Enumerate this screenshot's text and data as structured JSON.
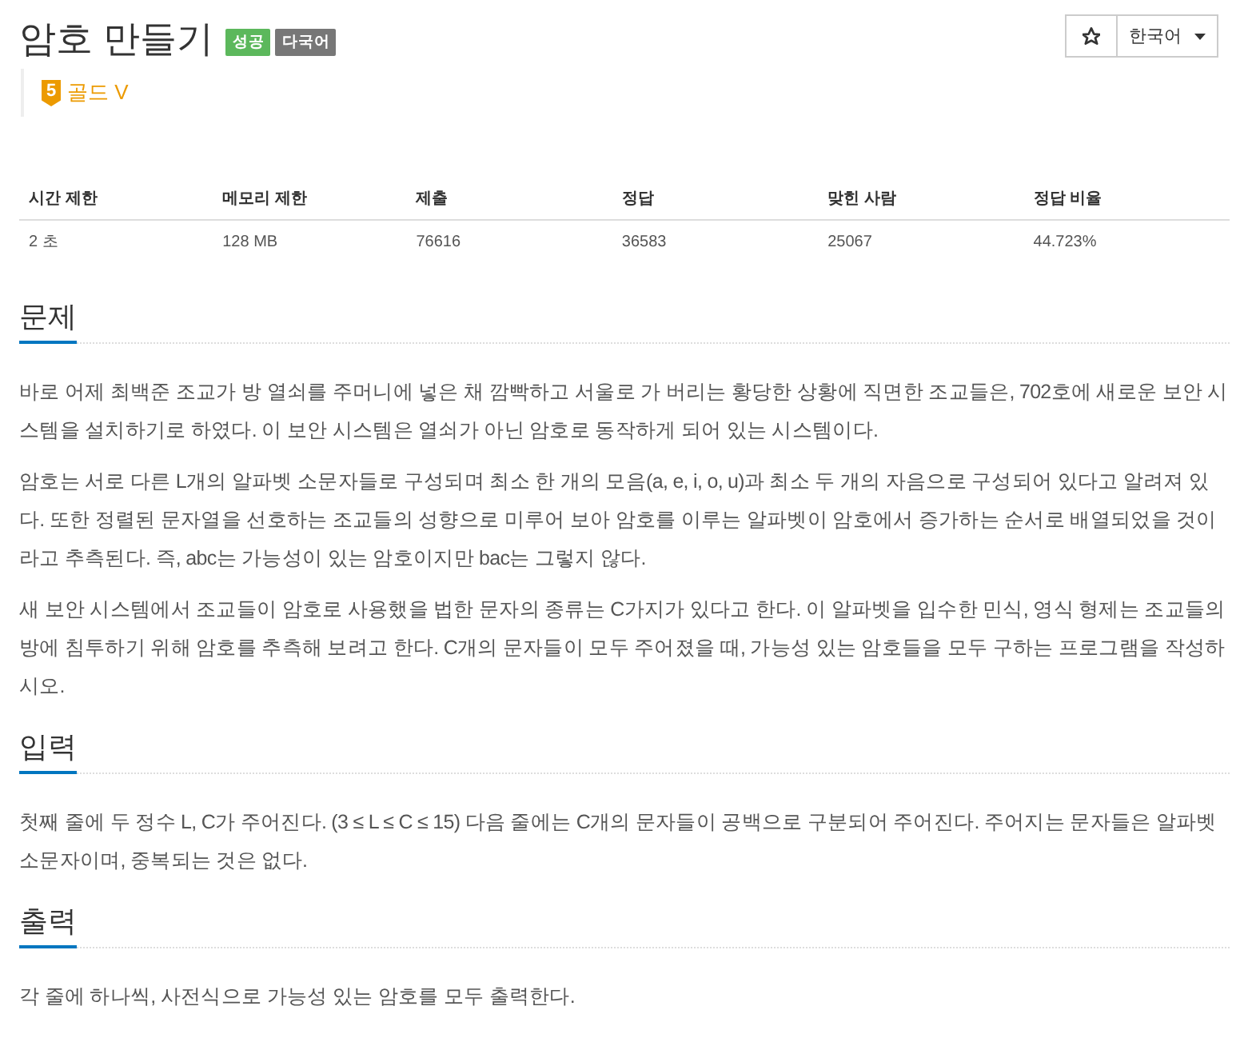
{
  "title": "암호 만들기",
  "badges": [
    {
      "label": "성공",
      "color": "#5cb85c"
    },
    {
      "label": "다국어",
      "color": "#777777"
    }
  ],
  "toolbar": {
    "language": "한국어"
  },
  "tier": {
    "level": "5",
    "label": "골드 V"
  },
  "stats_table": {
    "columns": [
      "시간 제한",
      "메모리 제한",
      "제출",
      "정답",
      "맞힌 사람",
      "정답 비율"
    ],
    "rows": [
      [
        "2 초",
        "128 MB",
        "76616",
        "36583",
        "25067",
        "44.723%"
      ]
    ]
  },
  "sections": [
    {
      "title": "문제",
      "paragraphs": [
        "바로 어제 최백준 조교가 방 열쇠를 주머니에 넣은 채 깜빡하고 서울로 가 버리는 황당한 상황에 직면한 조교들은, 702호에 새로운 보안 시스템을 설치하기로 하였다. 이 보안 시스템은 열쇠가 아닌 암호로 동작하게 되어 있는 시스템이다.",
        "암호는 서로 다른 L개의 알파벳 소문자들로 구성되며 최소 한 개의 모음(a, e, i, o, u)과 최소 두 개의 자음으로 구성되어 있다고 알려져 있다. 또한 정렬된 문자열을 선호하는 조교들의 성향으로 미루어 보아 암호를 이루는 알파벳이 암호에서 증가하는 순서로 배열되었을 것이라고 추측된다. 즉, abc는 가능성이 있는 암호이지만 bac는 그렇지 않다.",
        "새 보안 시스템에서 조교들이 암호로 사용했을 법한 문자의 종류는 C가지가 있다고 한다. 이 알파벳을 입수한 민식, 영식 형제는 조교들의 방에 침투하기 위해 암호를 추측해 보려고 한다. C개의 문자들이 모두 주어졌을 때, 가능성 있는 암호들을 모두 구하는 프로그램을 작성하시오."
      ]
    },
    {
      "title": "입력",
      "paragraphs": [
        "첫째 줄에 두 정수 L, C가 주어진다. (3 ≤ L ≤ C ≤ 15) 다음 줄에는 C개의 문자들이 공백으로 구분되어 주어진다. 주어지는 문자들은 알파벳 소문자이며, 중복되는 것은 없다."
      ]
    },
    {
      "title": "출력",
      "paragraphs": [
        "각 줄에 하나씩, 사전식으로 가능성 있는 암호를 모두 출력한다."
      ]
    }
  ]
}
